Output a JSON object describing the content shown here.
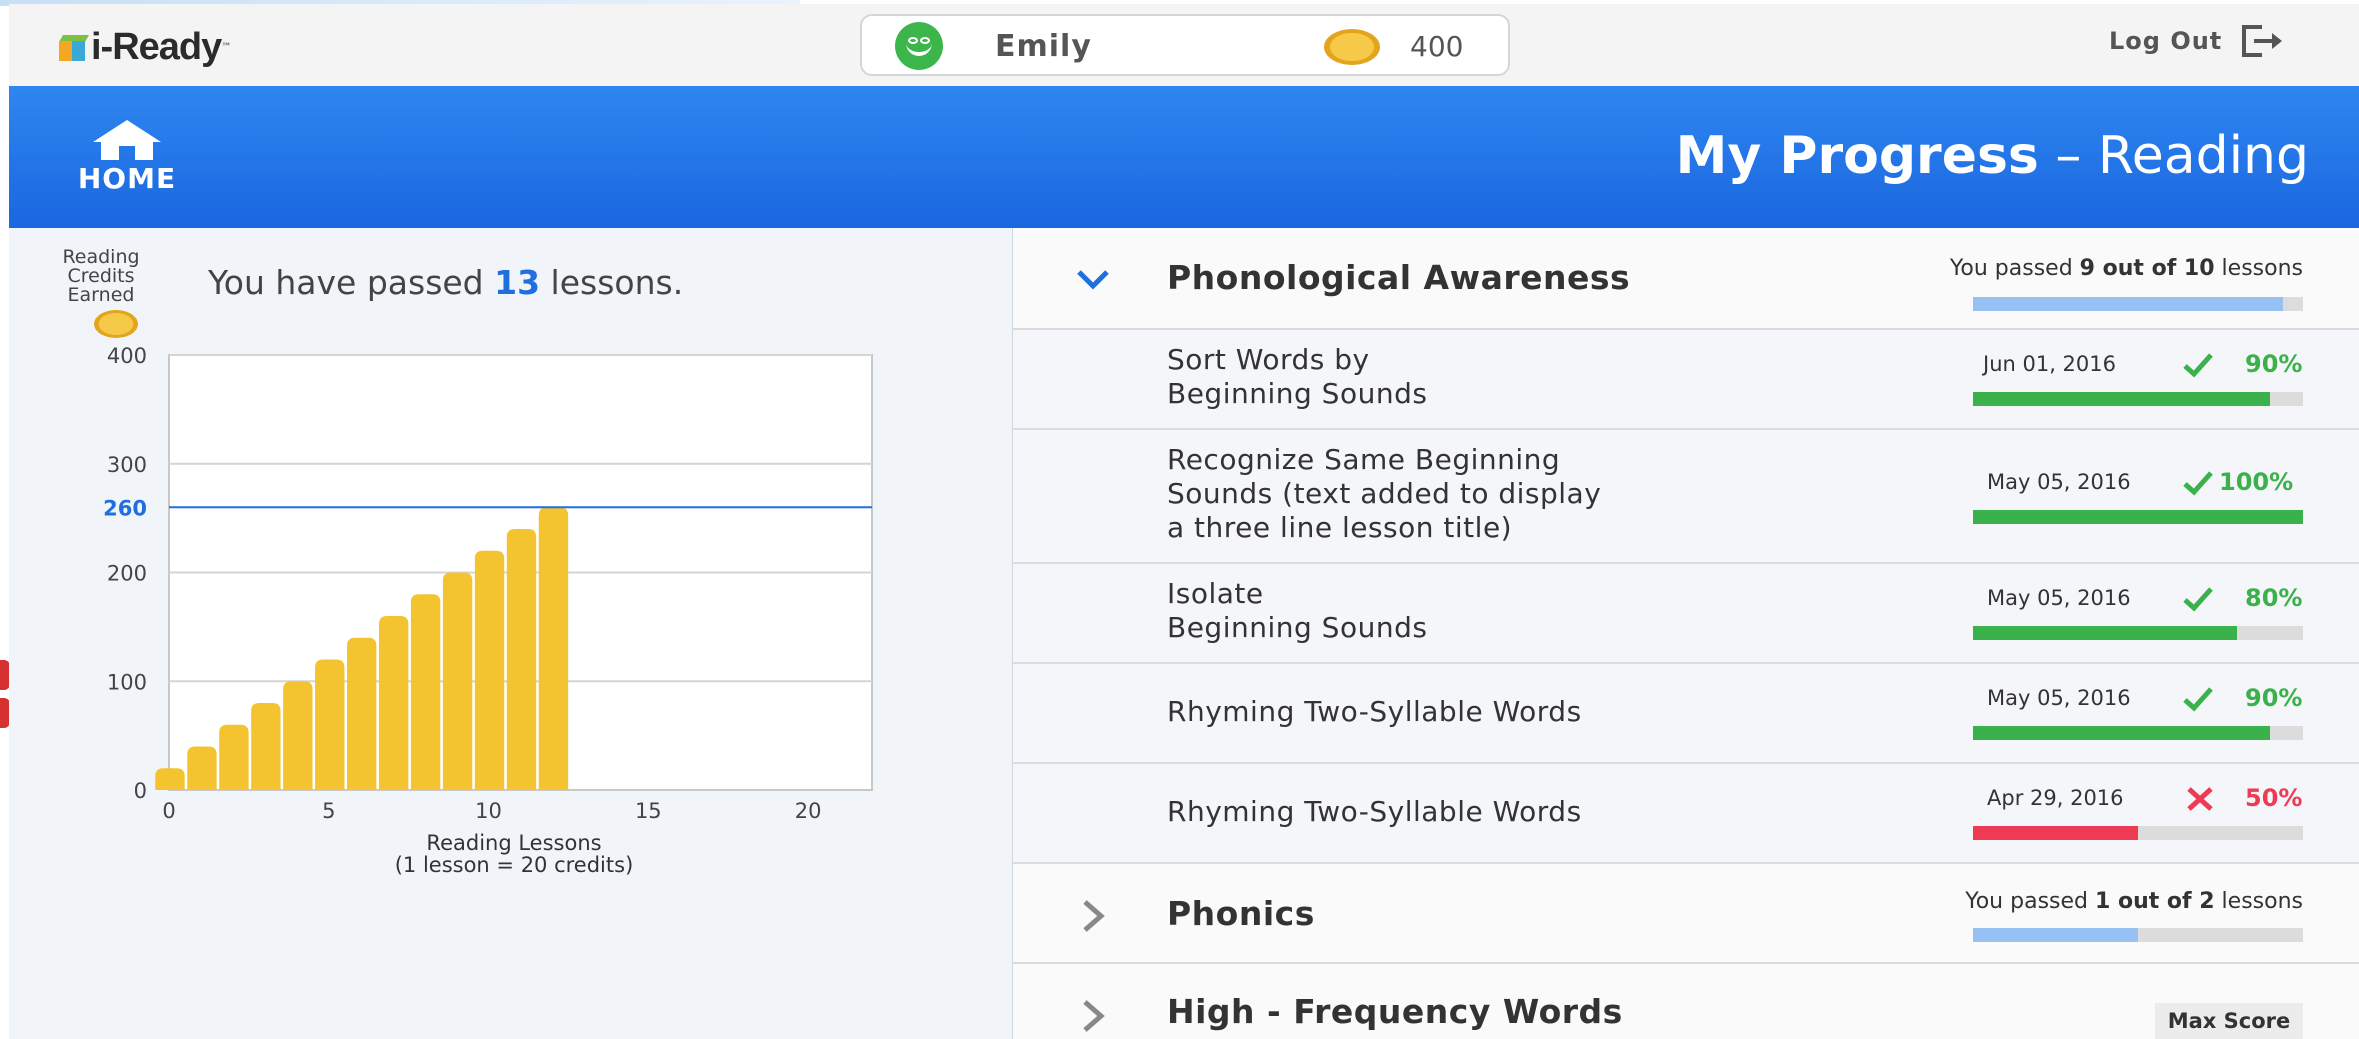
{
  "app": {
    "logo_text": "i-Ready",
    "logo_tm": "™"
  },
  "user": {
    "name": "Emily",
    "coins": "400"
  },
  "actions": {
    "logout_label": "Log Out",
    "home_label": "HOME"
  },
  "header": {
    "title_strong": "My Progress",
    "title_rest": " – Reading"
  },
  "summary": {
    "credits_label": "Reading Credits Earned",
    "passed_prefix": "You have passed ",
    "passed_count": "13",
    "passed_suffix": " lessons."
  },
  "chart_data": {
    "type": "bar",
    "x": [
      0,
      1,
      2,
      3,
      4,
      5,
      6,
      7,
      8,
      9,
      10,
      11,
      12
    ],
    "values": [
      20,
      40,
      60,
      80,
      100,
      120,
      140,
      160,
      180,
      200,
      220,
      240,
      260
    ],
    "xlim": [
      0,
      22
    ],
    "ylim": [
      0,
      400
    ],
    "x_ticks": [
      0,
      5,
      10,
      15,
      20
    ],
    "y_ticks": [
      0,
      100,
      200,
      300,
      400
    ],
    "reference_line": {
      "value": 260,
      "label": "260",
      "color": "#1f6fe0"
    },
    "xlabel": "Reading Lessons",
    "xlabel_note": "(1 lesson = 20 credits)",
    "ylabel": "Reading Credits Earned",
    "bar_color": "#f4c430",
    "grid": true
  },
  "sections": [
    {
      "title": "Phonological Awareness",
      "expanded": true,
      "summary_prefix": "You passed ",
      "summary_bold": "9 out of 10",
      "summary_suffix": " lessons",
      "progress": 0.94,
      "color": "#98c1f3"
    },
    {
      "title": "Phonics",
      "expanded": false,
      "summary_prefix": "You passed ",
      "summary_bold": "1 out of 2",
      "summary_suffix": " lessons",
      "progress": 0.5,
      "color": "#98c1f3"
    },
    {
      "title": "High - Frequency Words",
      "expanded": false,
      "max_score_label": "Max Score"
    }
  ],
  "lessons": [
    {
      "title_lines": [
        "Sort Words by",
        "Beginning Sounds"
      ],
      "date": "Jun 01, 2016",
      "passed": true,
      "score": "90%",
      "progress": 0.9
    },
    {
      "title_lines": [
        "Recognize Same Beginning",
        "Sounds (text added to display",
        "a three line lesson title)"
      ],
      "date": "May 05, 2016",
      "passed": true,
      "score": "100%",
      "progress": 1.0
    },
    {
      "title_lines": [
        "Isolate",
        "Beginning Sounds"
      ],
      "date": "May 05, 2016",
      "passed": true,
      "score": "80%",
      "progress": 0.8
    },
    {
      "title_lines": [
        "Rhyming Two-Syllable Words"
      ],
      "date": "May 05, 2016",
      "passed": true,
      "score": "90%",
      "progress": 0.9
    },
    {
      "title_lines": [
        "Rhyming Two-Syllable Words"
      ],
      "date": "Apr 29, 2016",
      "passed": false,
      "score": "50%",
      "progress": 0.5
    }
  ],
  "colors": {
    "pass": "#3ab14a",
    "fail": "#ee3b55",
    "accent": "#1f6fe0",
    "header_blue": "#2577e8"
  },
  "icons": {
    "home": "home-icon",
    "logout": "logout-icon",
    "coin": "coin-icon",
    "check": "check-icon",
    "cross": "cross-icon",
    "chevron_down": "chevron-down-icon",
    "chevron_right": "chevron-right-icon"
  }
}
